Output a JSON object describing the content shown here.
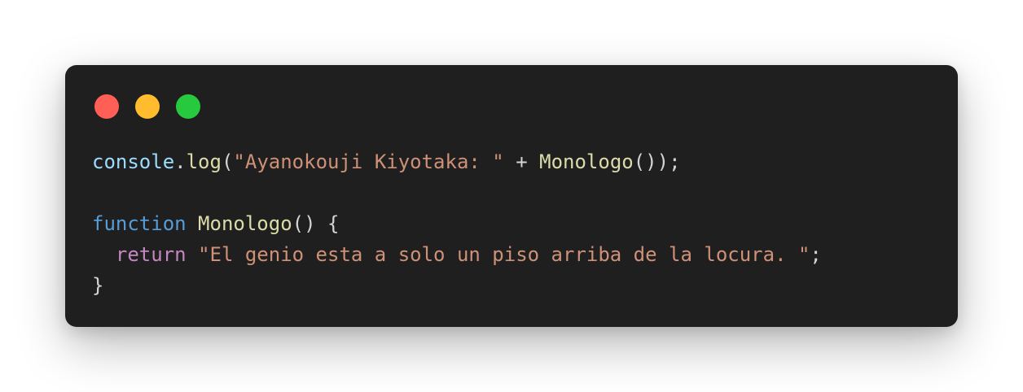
{
  "window": {
    "controls": [
      {
        "name": "close",
        "color": "#ff5f56"
      },
      {
        "name": "minimize",
        "color": "#ffbd2e"
      },
      {
        "name": "maximize",
        "color": "#27c93f"
      }
    ]
  },
  "code": {
    "lines": [
      [
        {
          "text": "console",
          "kind": "variable"
        },
        {
          "text": ".",
          "kind": "punctuation"
        },
        {
          "text": "log",
          "kind": "function"
        },
        {
          "text": "(",
          "kind": "punctuation"
        },
        {
          "text": "\"Ayanokouji Kiyotaka: \"",
          "kind": "string"
        },
        {
          "text": " + ",
          "kind": "punctuation"
        },
        {
          "text": "Monologo",
          "kind": "function"
        },
        {
          "text": "());",
          "kind": "punctuation"
        }
      ],
      [],
      [
        {
          "text": "function",
          "kind": "keyword"
        },
        {
          "text": " ",
          "kind": "punctuation"
        },
        {
          "text": "Monologo",
          "kind": "function"
        },
        {
          "text": "() {",
          "kind": "punctuation"
        }
      ],
      [
        {
          "text": "  ",
          "kind": "punctuation"
        },
        {
          "text": "return",
          "kind": "control"
        },
        {
          "text": " ",
          "kind": "punctuation"
        },
        {
          "text": "\"El genio esta a solo un piso arriba de la locura. \"",
          "kind": "string"
        },
        {
          "text": ";",
          "kind": "punctuation"
        }
      ],
      [
        {
          "text": "}",
          "kind": "punctuation"
        }
      ]
    ]
  }
}
